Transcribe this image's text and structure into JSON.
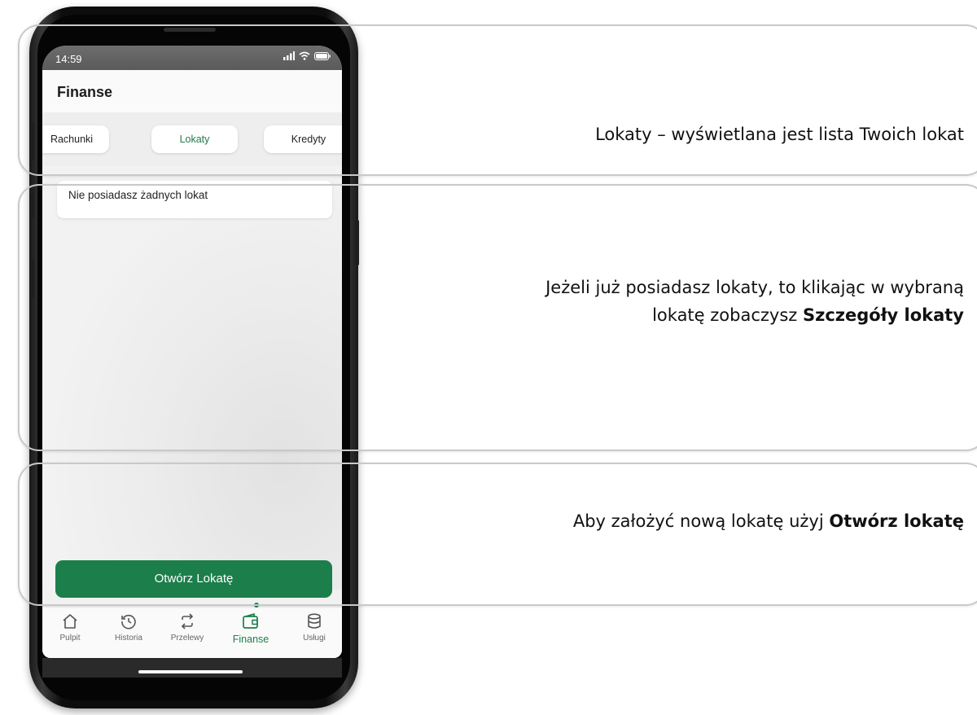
{
  "status_bar": {
    "time": "14:59"
  },
  "app": {
    "title": "Finanse"
  },
  "tabs": [
    {
      "label": "Rachunki"
    },
    {
      "label": "Lokaty"
    },
    {
      "label": "Kredyty"
    }
  ],
  "content": {
    "empty_message": "Nie posiadasz żadnych lokat"
  },
  "open_button": {
    "label": "Otwórz Lokatę"
  },
  "bottom_nav": [
    {
      "label": "Pulpit",
      "icon": "home-icon"
    },
    {
      "label": "Historia",
      "icon": "history-icon"
    },
    {
      "label": "Przelewy",
      "icon": "transfer-icon"
    },
    {
      "label": "Finanse",
      "icon": "wallet-icon"
    },
    {
      "label": "Usługi",
      "icon": "database-icon"
    }
  ],
  "callouts": {
    "one": {
      "text": "Lokaty – wyświetlana jest lista Twoich lokat"
    },
    "two": {
      "line1": "Jeżeli już posiadasz lokaty, to klikając w wybraną",
      "line2_pre": "lokatę zobaczysz ",
      "line2_bold": "Szczegóły lokaty"
    },
    "three": {
      "pre": "Aby założyć nową lokatę użyj ",
      "bold": "Otwórz lokatę"
    }
  },
  "colors": {
    "accent": "#1c7f4b",
    "callout_border": "#c9c9c9"
  }
}
